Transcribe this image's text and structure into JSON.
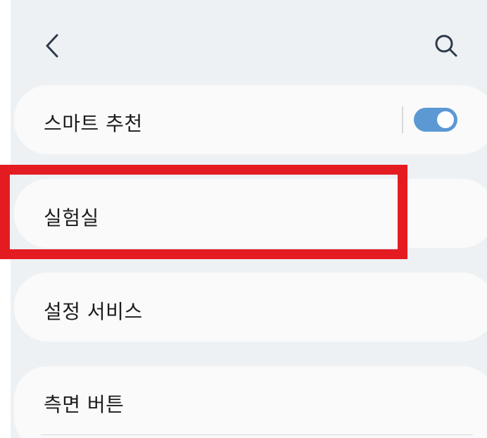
{
  "header": {
    "back_icon": "chevron-left-icon",
    "search_icon": "search-icon"
  },
  "menu": {
    "smart_recommendation": {
      "label": "스마트 추천",
      "toggle_on": true
    },
    "labs": {
      "label": "실험실"
    },
    "settings_services": {
      "label": "설정 서비스"
    },
    "side_button": {
      "label": "측면 버튼"
    }
  },
  "colors": {
    "background": "#eef1f4",
    "card": "#fafafa",
    "toggle_on": "#5b98d4",
    "highlight_box": "#e41c22"
  }
}
